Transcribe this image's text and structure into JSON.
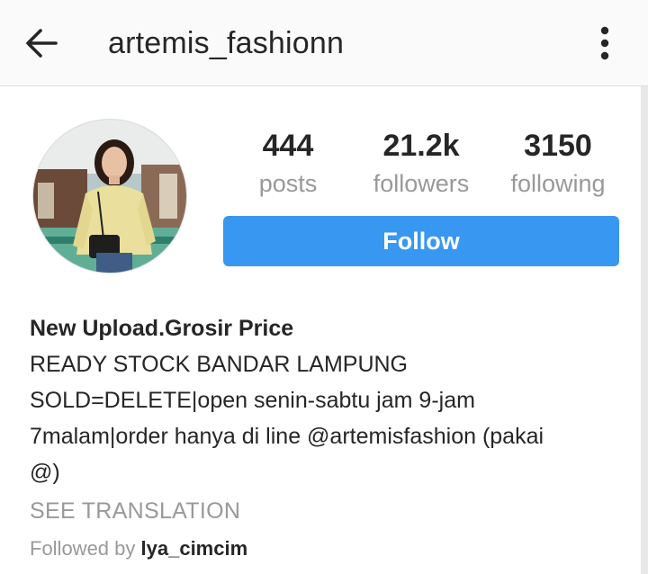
{
  "header": {
    "back_icon": "arrow-left-icon",
    "title": "artemis_fashionn",
    "more_icon": "more-vertical-icon"
  },
  "profile": {
    "avatar_alt": "profile photo",
    "stats": [
      {
        "value": "444",
        "label": "posts"
      },
      {
        "value": "21.2k",
        "label": "followers"
      },
      {
        "value": "3150",
        "label": "following"
      }
    ],
    "follow_label": "Follow"
  },
  "bio": {
    "name": "New Upload.Grosir Price",
    "lines": [
      "READY STOCK BANDAR LAMPUNG",
      "SOLD=DELETE|open senin-sabtu jam 9-jam",
      "7malam|order hanya di line @artemisfashion (pakai",
      "@)"
    ],
    "see_translation": "SEE TRANSLATION",
    "followed_by_prefix": "Followed by",
    "followed_by_user": "lya_cimcim"
  },
  "colors": {
    "accent": "#3897f0",
    "text_primary": "#262626",
    "text_secondary": "#999999",
    "header_bg": "#fafafa"
  }
}
